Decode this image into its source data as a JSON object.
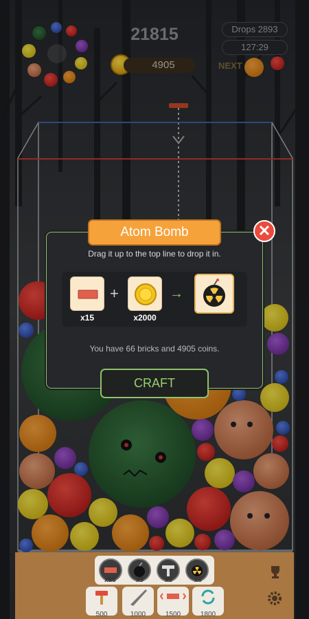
{
  "hud": {
    "score": "21815",
    "drops": "Drops 2893",
    "timer": "127:29",
    "coins": "4905",
    "next_label": "NEXT"
  },
  "modal": {
    "title": "Atom Bomb",
    "hint": "Drag it up to the top line to drop it in.",
    "brick_qty": "x15",
    "coin_qty": "x2000",
    "plus": "+",
    "arrow": "→",
    "have_text": "You have 66 bricks and 4905 coins.",
    "craft_label": "CRAFT",
    "close_glyph": "✕"
  },
  "inventory": [
    {
      "name": "brick",
      "count": "x66",
      "icon": "brick-icon"
    },
    {
      "name": "bomb",
      "count": "x9",
      "icon": "bomb-icon"
    },
    {
      "name": "hammer",
      "count": "x5",
      "icon": "t-hammer-icon"
    },
    {
      "name": "atom-bomb",
      "count": "x0",
      "icon": "radiation-bomb-icon"
    }
  ],
  "tools": [
    {
      "name": "hammer",
      "price": "500",
      "icon": "hammer-icon"
    },
    {
      "name": "knife",
      "price": "1000",
      "icon": "knife-icon"
    },
    {
      "name": "shake",
      "price": "1500",
      "icon": "shake-icon"
    },
    {
      "name": "shuffle",
      "price": "1800",
      "icon": "refresh-icon"
    }
  ],
  "colors": {
    "accent_green": "#8fc36a",
    "title_orange": "#f6a23b",
    "close_red": "#e94c3d",
    "panel_brown": "#a97742"
  }
}
